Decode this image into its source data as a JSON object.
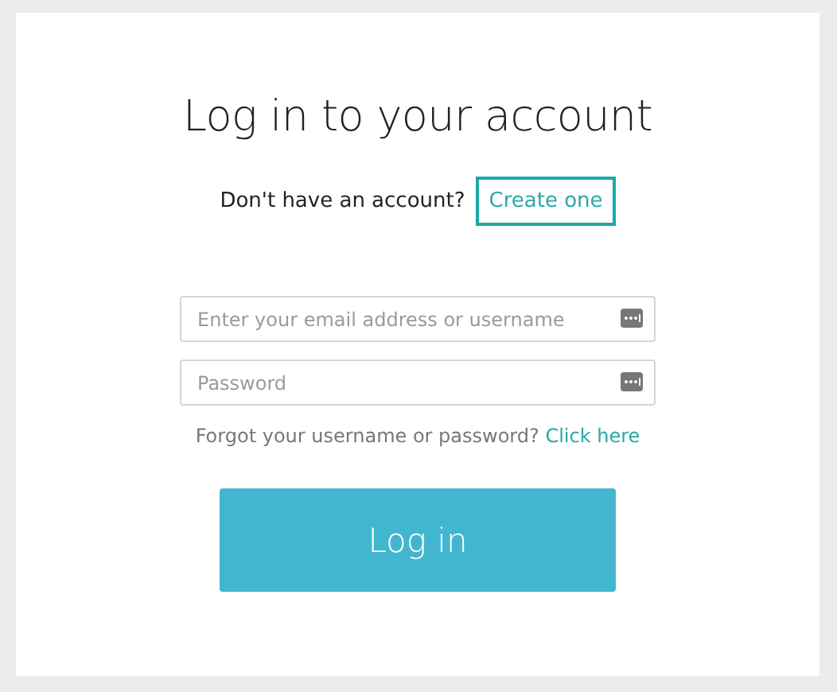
{
  "title": "Log in to your account",
  "signup": {
    "prompt": "Don't have an account?",
    "link": "Create one",
    "focused": true
  },
  "fields": [
    {
      "placeholder": "Enter your email address or username"
    },
    {
      "placeholder": "Password"
    }
  ],
  "forgot": {
    "text": "Forgot your username or password?",
    "link": "Click here"
  },
  "button": "Log in"
}
